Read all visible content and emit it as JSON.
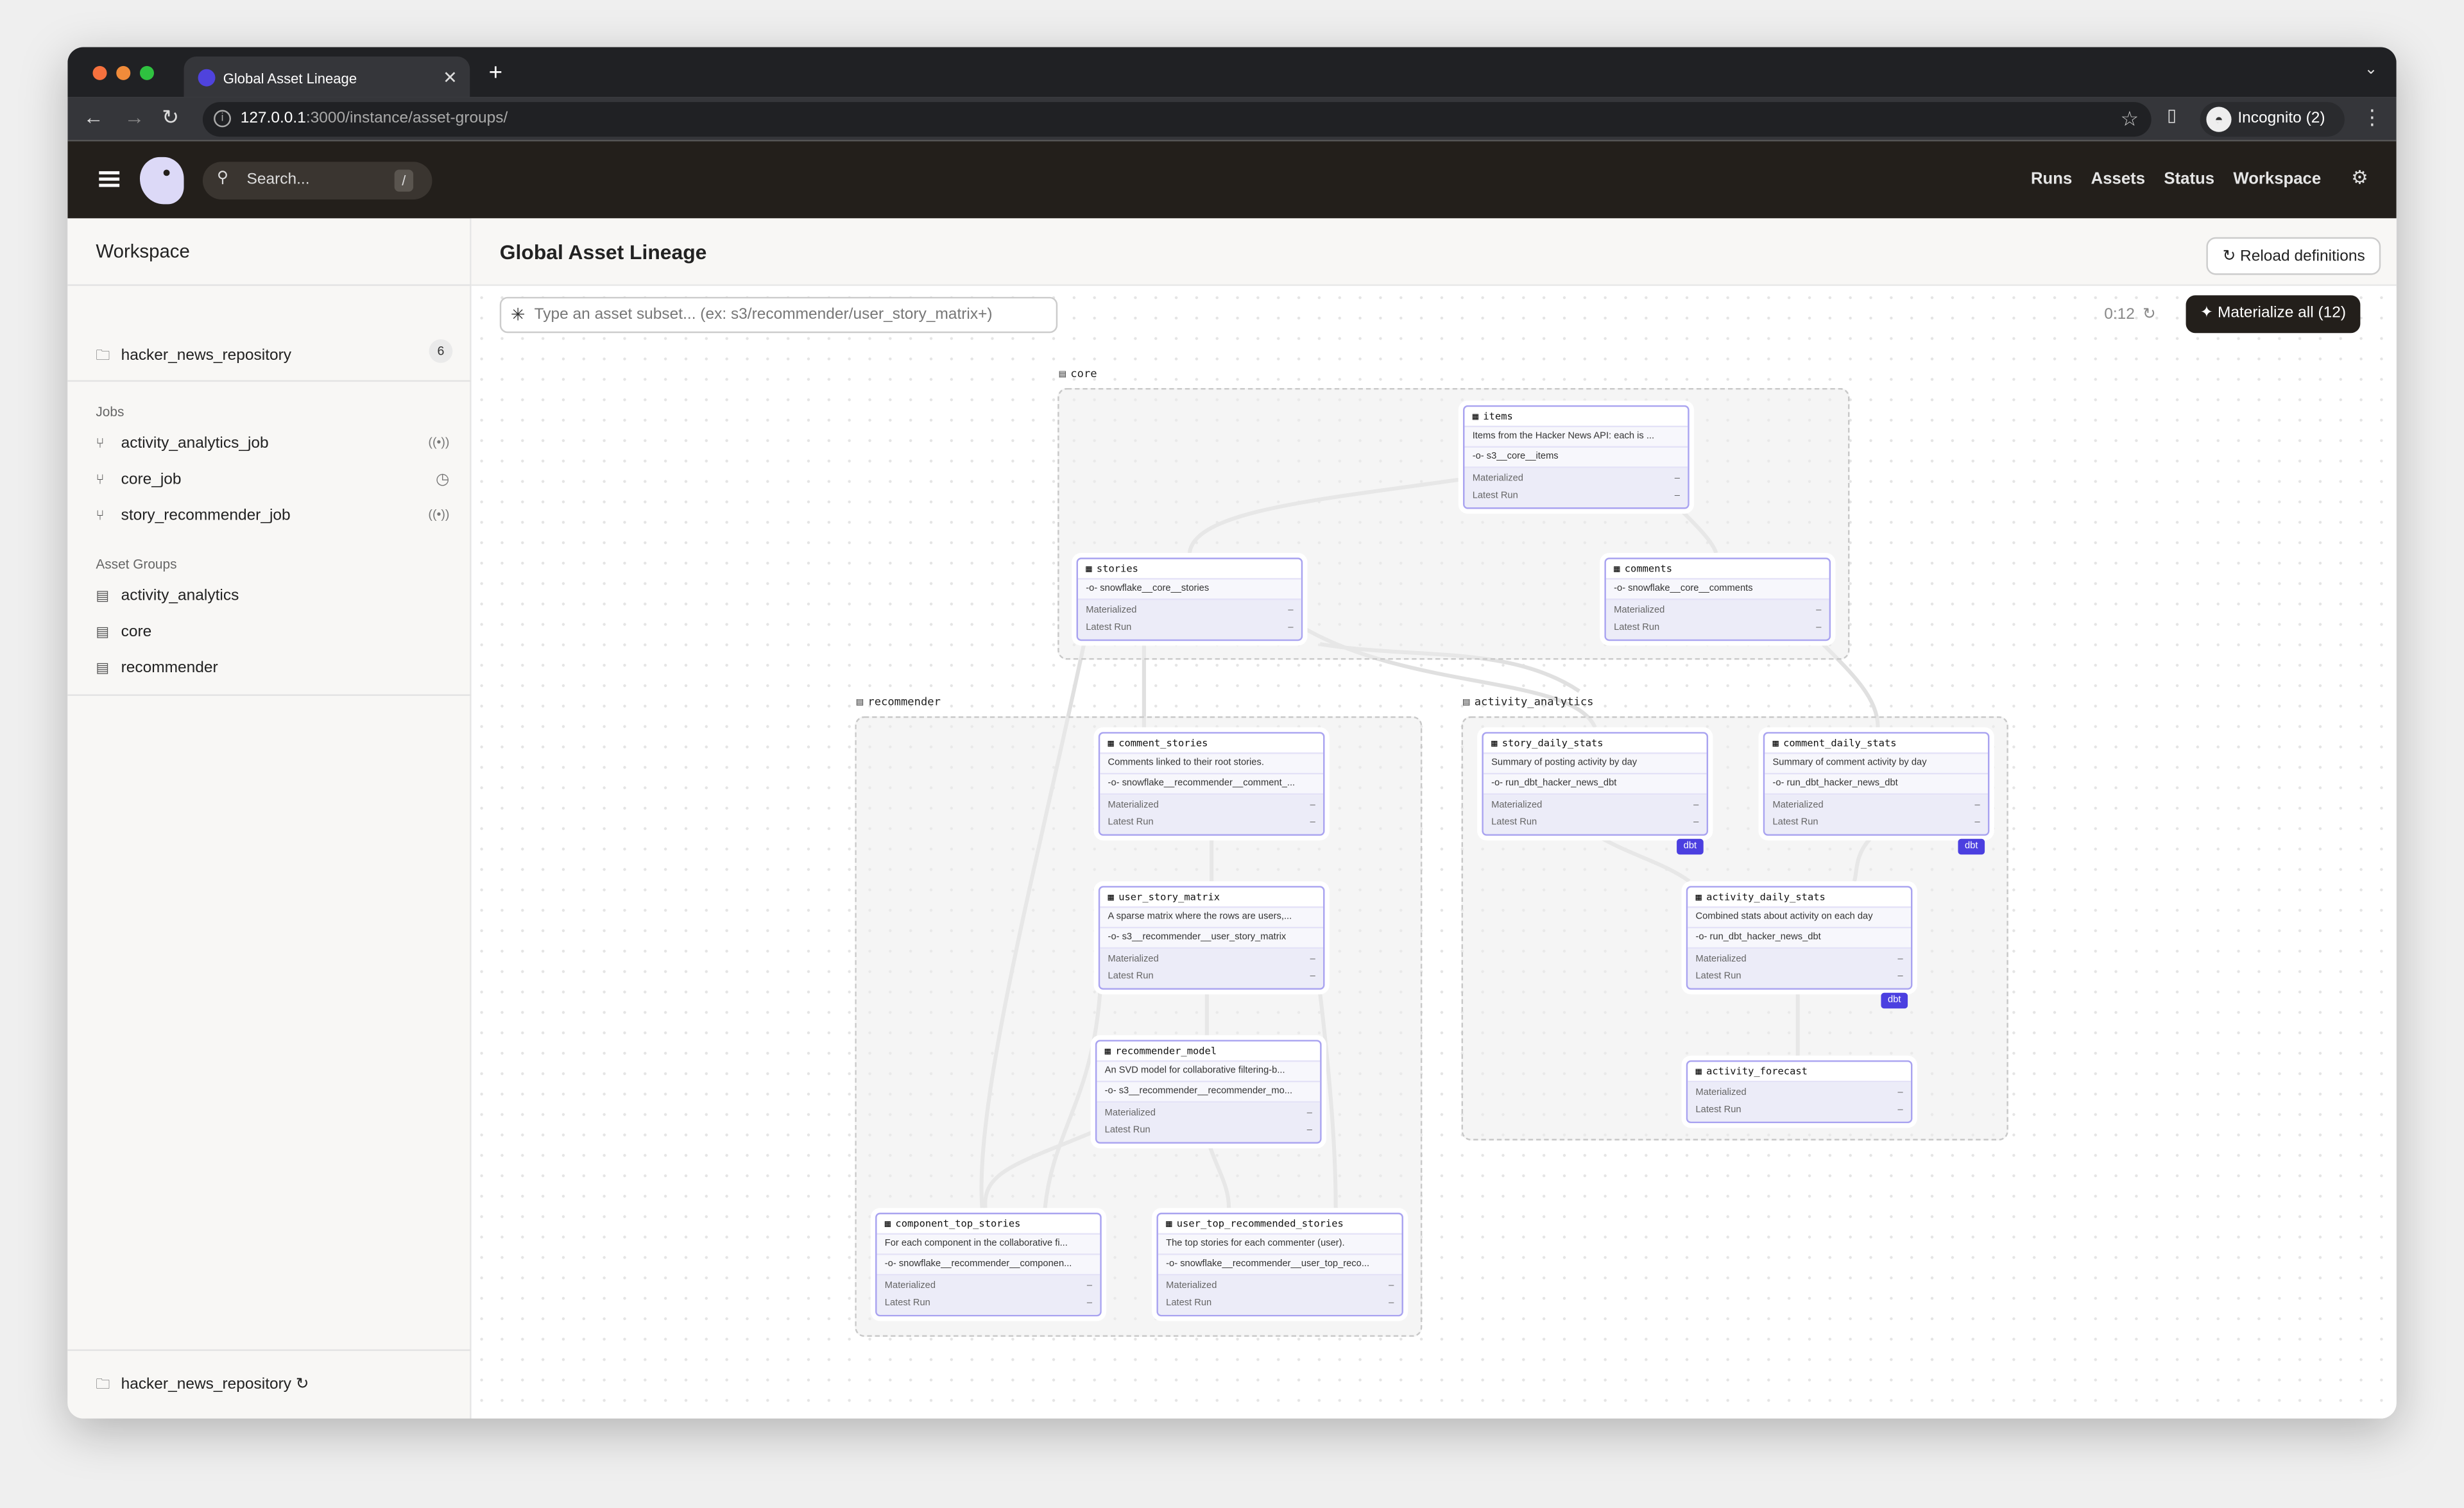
{
  "browser": {
    "tab_title": "Global Asset Lineage",
    "url_host": "127.0.0.1",
    "url_rest": ":3000/instance/asset-groups/",
    "profile": "Incognito (2)"
  },
  "header": {
    "search_placeholder": "Search...",
    "search_shortcut": "/",
    "nav": [
      "Runs",
      "Assets",
      "Status",
      "Workspace"
    ]
  },
  "sidebar": {
    "title": "Workspace",
    "repo": {
      "name": "hacker_news_repository",
      "count": "6"
    },
    "jobs_label": "Jobs",
    "jobs": [
      {
        "name": "activity_analytics_job",
        "icon": "sensor-icon"
      },
      {
        "name": "core_job",
        "icon": "clock-icon"
      },
      {
        "name": "story_recommender_job",
        "icon": "sensor-icon"
      }
    ],
    "groups_label": "Asset Groups",
    "groups": [
      "activity_analytics",
      "core",
      "recommender"
    ],
    "footer_repo": "hacker_news_repository"
  },
  "main": {
    "title": "Global Asset Lineage",
    "reload_label": "Reload definitions",
    "filter_placeholder": "Type an asset subset... (ex: s3/recommender/user_story_matrix+)",
    "timer": "0:12",
    "materialize_label": "Materialize all (12)"
  },
  "graph": {
    "status_labels": {
      "materialized": "Materialized",
      "latest_run": "Latest Run",
      "empty": "–"
    },
    "groups": [
      "core",
      "recommender",
      "activity_analytics"
    ],
    "nodes": [
      {
        "name": "items",
        "description": "Items from the Hacker News API: each is ...",
        "op": "s3__core__items"
      },
      {
        "name": "stories",
        "description": "",
        "op": "snowflake__core__stories"
      },
      {
        "name": "comments",
        "description": "",
        "op": "snowflake__core__comments"
      },
      {
        "name": "comment_stories",
        "description": "Comments linked to their root stories.",
        "op": "snowflake__recommender__comment_..."
      },
      {
        "name": "user_story_matrix",
        "description": "A sparse matrix where the rows are users,...",
        "op": "s3__recommender__user_story_matrix"
      },
      {
        "name": "recommender_model",
        "description": "An SVD model for collaborative filtering-b...",
        "op": "s3__recommender__recommender_mo..."
      },
      {
        "name": "component_top_stories",
        "description": "For each component in the collaborative fi...",
        "op": "snowflake__recommender__componen..."
      },
      {
        "name": "user_top_recommended_stories",
        "description": "The top stories for each commenter (user).",
        "op": "snowflake__recommender__user_top_reco..."
      },
      {
        "name": "story_daily_stats",
        "description": "Summary of posting activity by day",
        "op": "run_dbt_hacker_news_dbt",
        "badge": "dbt"
      },
      {
        "name": "comment_daily_stats",
        "description": "Summary of comment activity by day",
        "op": "run_dbt_hacker_news_dbt",
        "badge": "dbt"
      },
      {
        "name": "activity_daily_stats",
        "description": "Combined stats about activity on each day",
        "op": "run_dbt_hacker_news_dbt",
        "badge": "dbt"
      },
      {
        "name": "activity_forecast",
        "description": "",
        "op": ""
      }
    ]
  },
  "colors": {
    "accent": "#4b3fe0",
    "node_border": "#a9a3f0",
    "header_bg": "#231f1b"
  }
}
